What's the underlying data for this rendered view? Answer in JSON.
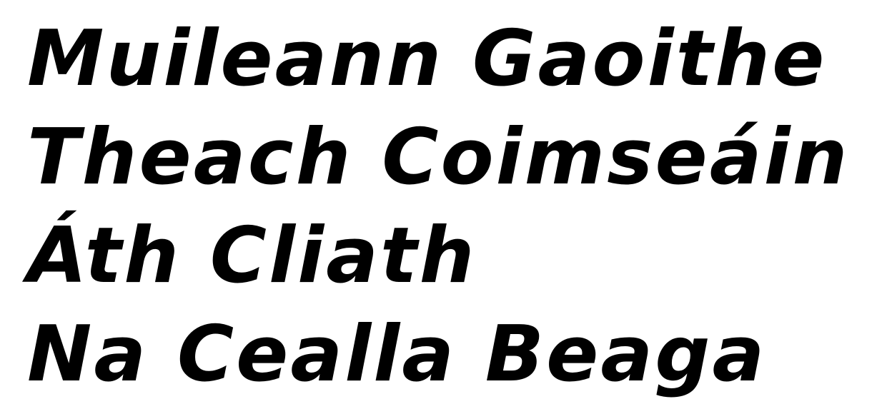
{
  "specimen": {
    "lines": [
      "Muileann Gaoithe",
      "Theach Coimseáin",
      "Áth Cliath",
      "Na Cealla Beaga"
    ]
  },
  "colors": {
    "text": "#000000",
    "background": "#ffffff"
  }
}
